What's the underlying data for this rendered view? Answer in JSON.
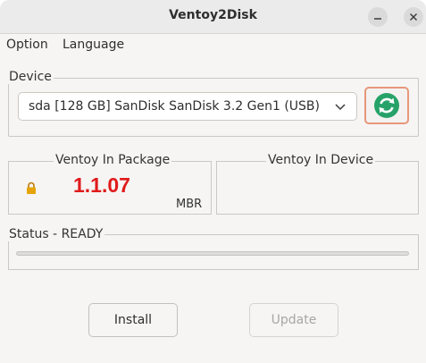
{
  "window": {
    "title": "Ventoy2Disk"
  },
  "menu": {
    "items": [
      "Option",
      "Language"
    ]
  },
  "device": {
    "group_label": "Device",
    "selected": "sda  [128 GB]  SanDisk SanDisk 3.2 Gen1 (USB)"
  },
  "package": {
    "label": "Ventoy In Package",
    "version": "1.1.07",
    "partition_style": "MBR"
  },
  "in_device": {
    "label": "Ventoy In Device"
  },
  "status": {
    "label": "Status - READY",
    "progress": 0
  },
  "buttons": {
    "install": "Install",
    "update": "Update"
  },
  "colors": {
    "version": "#e01b1b",
    "refresh_accent": "#26a269",
    "refresh_border": "#e8967a",
    "lock": "#e5a50a"
  },
  "icons": {
    "refresh": "refresh-icon",
    "lock": "lock-icon",
    "dropdown": "chevron-down-icon"
  }
}
